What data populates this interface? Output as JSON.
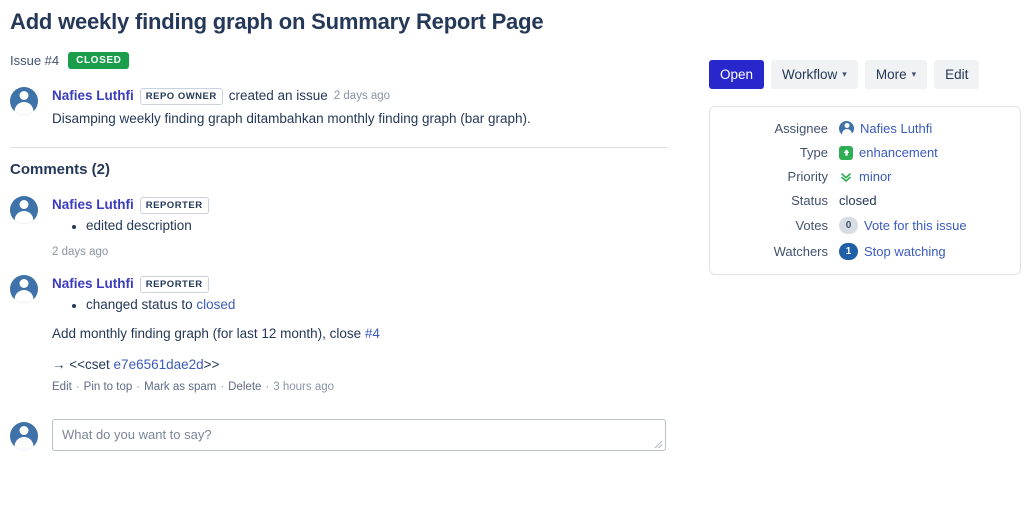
{
  "header": {
    "title": "Add weekly finding graph on Summary Report Page",
    "issue_number": "Issue #4",
    "status_badge": "CLOSED"
  },
  "colors": {
    "primary_button": "#2727cc",
    "closed_badge": "#1b9e4b",
    "link": "#3b5bbd",
    "user_link": "#3b3bbd",
    "type_icon": "#2fae56",
    "watchers_pill": "#1e5fa8"
  },
  "original_post": {
    "author": "Nafies Luthfi",
    "role_badge": "REPO OWNER",
    "action": "created an issue",
    "time": "2 days ago",
    "body": "Disamping weekly finding graph ditambahkan monthly finding graph (bar graph)."
  },
  "comments_section": {
    "heading": "Comments (2)",
    "comments": [
      {
        "author": "Nafies Luthfi",
        "role_badge": "REPORTER",
        "change": "edited description",
        "time": "2 days ago"
      },
      {
        "author": "Nafies Luthfi",
        "role_badge": "REPORTER",
        "change_prefix": "changed status to",
        "change_link": "closed",
        "text_before_ref": "Add monthly finding graph (for last 12 month), close ",
        "text_ref": "#4",
        "cset_arrow": "→",
        "cset_open": "<<cset ",
        "cset_hash": "e7e6561dae2d",
        "cset_close": ">>",
        "actions": [
          "Edit",
          "Pin to top",
          "Mark as spam",
          "Delete"
        ],
        "time": "3 hours ago"
      }
    ]
  },
  "reply": {
    "placeholder": "What do you want to say?",
    "value": ""
  },
  "toolbar": {
    "open_label": "Open",
    "workflow_label": "Workflow",
    "more_label": "More",
    "edit_label": "Edit",
    "caret": "⌄"
  },
  "info_panel": {
    "assignee_label": "Assignee",
    "assignee_value": "Nafies Luthfi",
    "type_label": "Type",
    "type_value": "enhancement",
    "type_icon_glyph": "↑",
    "priority_label": "Priority",
    "priority_value": "minor",
    "priority_icon_glyph": "»",
    "status_label": "Status",
    "status_value": "closed",
    "votes_label": "Votes",
    "votes_count": "0",
    "votes_action": "Vote for this issue",
    "watchers_label": "Watchers",
    "watchers_count": "1",
    "watchers_action": "Stop watching"
  }
}
